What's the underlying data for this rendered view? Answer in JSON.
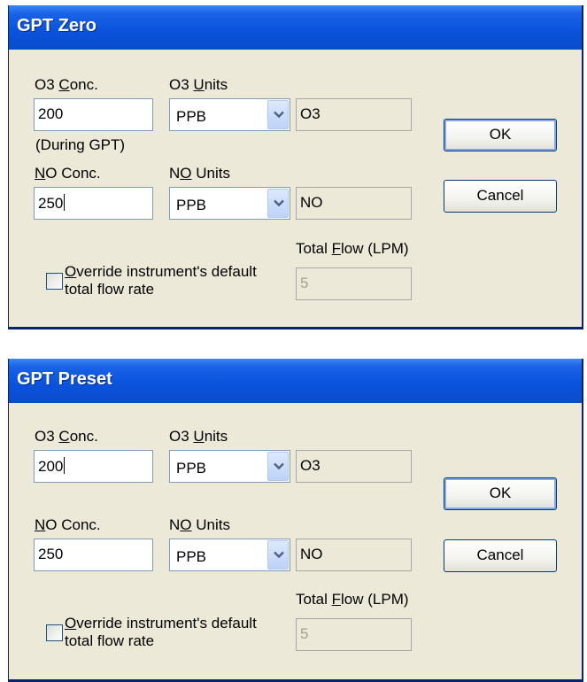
{
  "dialogs": [
    {
      "title": "GPT Zero",
      "o3_conc": {
        "pre": "O3 ",
        "key": "C",
        "post": "onc.",
        "value": "200",
        "note": "(During GPT)"
      },
      "o3_units": {
        "pre": "O3 ",
        "key": "U",
        "post": "nits",
        "selected": "PPB",
        "gas": "O3"
      },
      "no_conc": {
        "pre": "",
        "key": "N",
        "post": "O Conc.",
        "value": "250"
      },
      "no_units": {
        "pre": "N",
        "key": "O",
        "post": " Units",
        "selected": "PPB",
        "gas": "NO"
      },
      "total_flow": {
        "pre": "Total ",
        "key": "F",
        "post": "low (LPM)",
        "value": "5"
      },
      "override": {
        "key": "O",
        "line1_rest": "verride instrument's default",
        "line2": "total flow rate",
        "checked": false
      },
      "ok_label": "OK",
      "cancel_label": "Cancel"
    },
    {
      "title": "GPT Preset",
      "o3_conc": {
        "pre": "O3 ",
        "key": "C",
        "post": "onc.",
        "value": "200"
      },
      "o3_units": {
        "pre": "O3 ",
        "key": "U",
        "post": "nits",
        "selected": "PPB",
        "gas": "O3"
      },
      "no_conc": {
        "pre": "",
        "key": "N",
        "post": "O Conc.",
        "value": "250"
      },
      "no_units": {
        "pre": "N",
        "key": "O",
        "post": " Units",
        "selected": "PPB",
        "gas": "NO"
      },
      "total_flow": {
        "pre": "Total ",
        "key": "F",
        "post": "low (LPM)",
        "value": "5"
      },
      "override": {
        "key": "O",
        "line1_rest": "verride instrument's default",
        "line2": "total flow rate",
        "checked": false
      },
      "ok_label": "OK",
      "cancel_label": "Cancel"
    }
  ],
  "theme": {
    "titlebar": "#0a53dd",
    "face": "#ece9d8",
    "border": "#0a246a"
  }
}
